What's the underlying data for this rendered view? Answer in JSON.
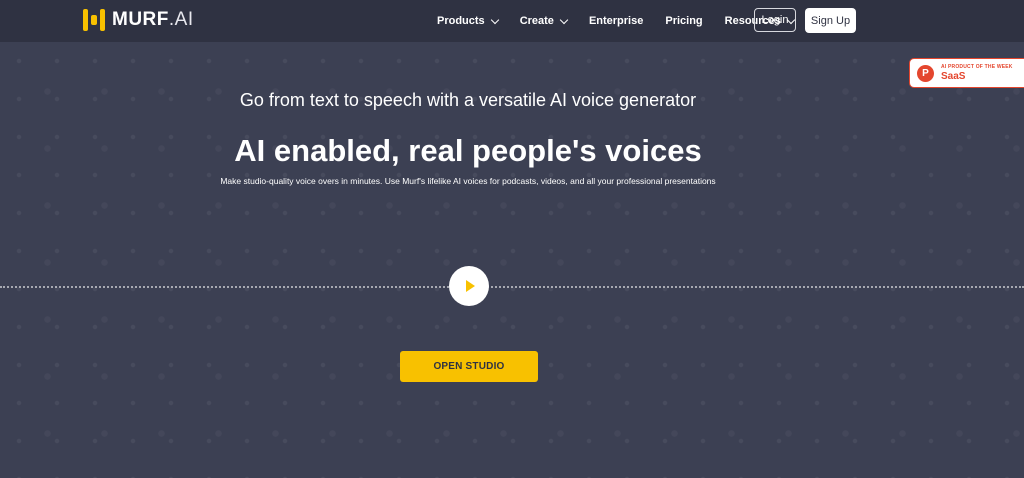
{
  "brand": {
    "name": "MURF",
    "suffix": ".AI"
  },
  "nav": {
    "items": [
      {
        "label": "Products",
        "has_dropdown": true
      },
      {
        "label": "Create",
        "has_dropdown": true
      },
      {
        "label": "Enterprise",
        "has_dropdown": false
      },
      {
        "label": "Pricing",
        "has_dropdown": false
      },
      {
        "label": "Resources",
        "has_dropdown": true
      }
    ],
    "login_label": "Login",
    "signup_label": "Sign Up"
  },
  "badge": {
    "letter": "P",
    "small": "AI PRODUCT OF THE WEEK",
    "big": "SaaS"
  },
  "hero": {
    "subtitle": "Go from text to speech with a versatile AI voice generator",
    "headline": "AI enabled, real people's voices",
    "description": "Make studio-quality voice overs in minutes. Use Murf's lifelike AI voices for podcasts, videos, and all your professional presentations",
    "cta_label": "OPEN STUDIO"
  },
  "colors": {
    "accent": "#f8c100",
    "nav_bg": "#2f3242",
    "page_bg": "#3c4053",
    "badge": "#e4462e"
  }
}
